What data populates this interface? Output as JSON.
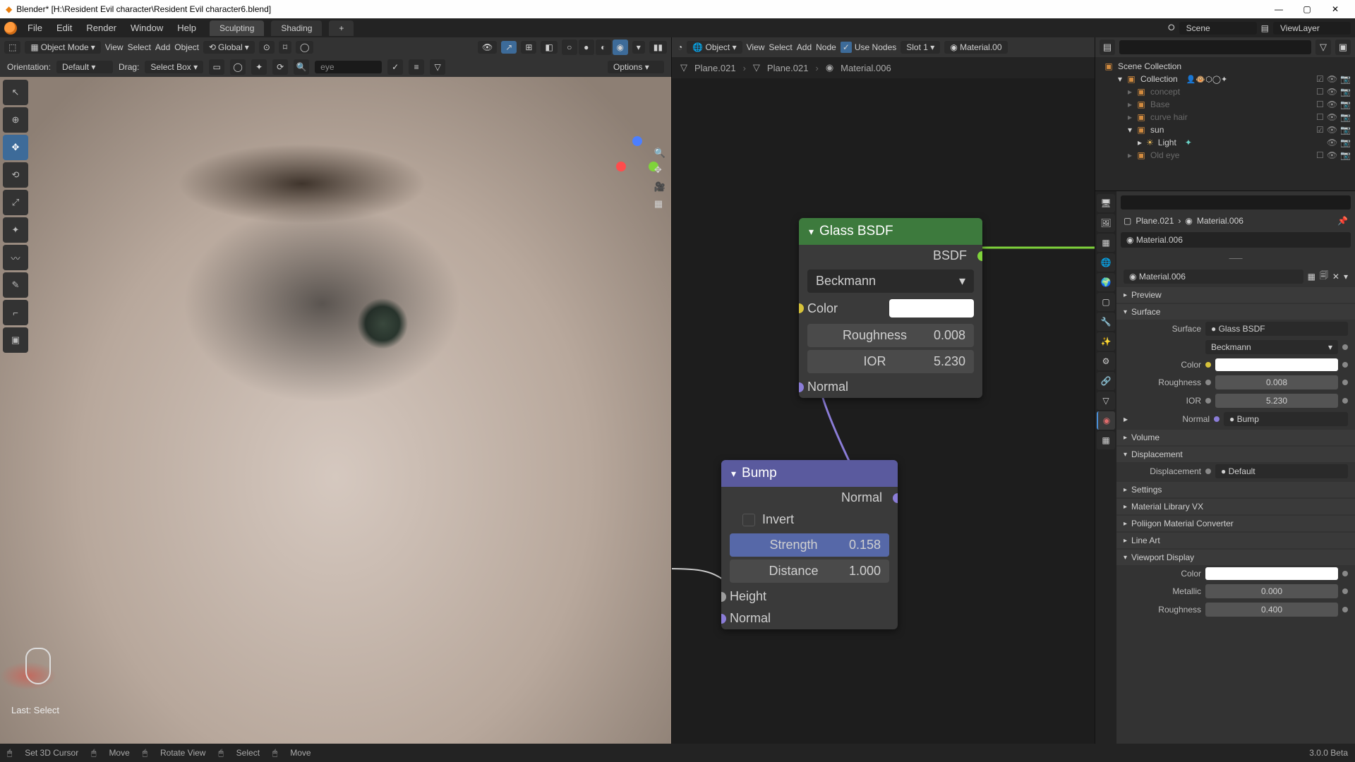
{
  "titlebar": {
    "icon": "blender-icon",
    "text": "Blender* [H:\\Resident Evil character\\Resident Evil character6.blend]"
  },
  "menubar": {
    "items": [
      "File",
      "Edit",
      "Render",
      "Window",
      "Help"
    ],
    "tabs": [
      "Sculpting",
      "Shading",
      "+"
    ],
    "scene_label": "Scene",
    "viewlayer_label": "ViewLayer"
  },
  "viewport": {
    "mode": "Object Mode",
    "menus": [
      "View",
      "Select",
      "Add",
      "Object"
    ],
    "orientation": "Global",
    "row2": {
      "orientation_label": "Orientation:",
      "orientation_value": "Default",
      "drag_label": "Drag:",
      "drag_value": "Select Box",
      "search_value": "eye",
      "options_label": "Options"
    },
    "tools": [
      "cursor",
      "select",
      "move",
      "rotate",
      "scale",
      "transform",
      "annotate",
      "measure",
      "add"
    ],
    "last_operator": "Last: Select"
  },
  "node_editor": {
    "menus": [
      "View",
      "Select",
      "Add",
      "Node"
    ],
    "object_label": "Object",
    "use_nodes_label": "Use Nodes",
    "slot_label": "Slot 1",
    "material_label": "Material.00",
    "breadcrumb": [
      "Plane.021",
      "Plane.021",
      "Material.006"
    ],
    "glass_node": {
      "title": "Glass BSDF",
      "out": "BSDF",
      "distribution": "Beckmann",
      "color_label": "Color",
      "roughness_label": "Roughness",
      "roughness_value": "0.008",
      "ior_label": "IOR",
      "ior_value": "5.230",
      "normal_label": "Normal"
    },
    "bump_node": {
      "title": "Bump",
      "out": "Normal",
      "invert_label": "Invert",
      "strength_label": "Strength",
      "strength_value": "0.158",
      "distance_label": "Distance",
      "distance_value": "1.000",
      "height_label": "Height",
      "normal_label": "Normal"
    }
  },
  "outliner": {
    "root": "Scene Collection",
    "items": [
      {
        "name": "Collection",
        "depth": 1,
        "dim": false
      },
      {
        "name": "concept",
        "depth": 2,
        "dim": true
      },
      {
        "name": "Base",
        "depth": 2,
        "dim": true
      },
      {
        "name": "curve hair",
        "depth": 2,
        "dim": true
      },
      {
        "name": "sun",
        "depth": 2,
        "dim": false
      },
      {
        "name": "Light",
        "depth": 3,
        "dim": false
      },
      {
        "name": "Old eye",
        "depth": 2,
        "dim": true
      }
    ]
  },
  "properties": {
    "object": "Plane.021",
    "material": "Material.006",
    "slot": "Material.006",
    "mat_dd": "Material.006",
    "panels": {
      "preview": "Preview",
      "surface": "Surface",
      "volume": "Volume",
      "displacement": "Displacement",
      "settings": "Settings",
      "matlib": "Material Library VX",
      "poliigon": "Poliigon Material Converter",
      "lineart": "Line Art",
      "viewport": "Viewport Display"
    },
    "surface": {
      "surface_label": "Surface",
      "surface_value": "Glass BSDF",
      "dist_value": "Beckmann",
      "color_label": "Color",
      "roughness_label": "Roughness",
      "roughness_value": "0.008",
      "ior_label": "IOR",
      "ior_value": "5.230",
      "normal_label": "Normal",
      "normal_value": "Bump"
    },
    "displacement": {
      "label": "Displacement",
      "value": "Default"
    },
    "viewport": {
      "color_label": "Color",
      "metallic_label": "Metallic",
      "metallic_value": "0.000",
      "roughness_label": "Roughness",
      "roughness_value": "0.400"
    }
  },
  "statusbar": {
    "items": [
      "Set 3D Cursor",
      "Move",
      "Rotate View",
      "Select",
      "Move"
    ],
    "version": "3.0.0 Beta"
  }
}
